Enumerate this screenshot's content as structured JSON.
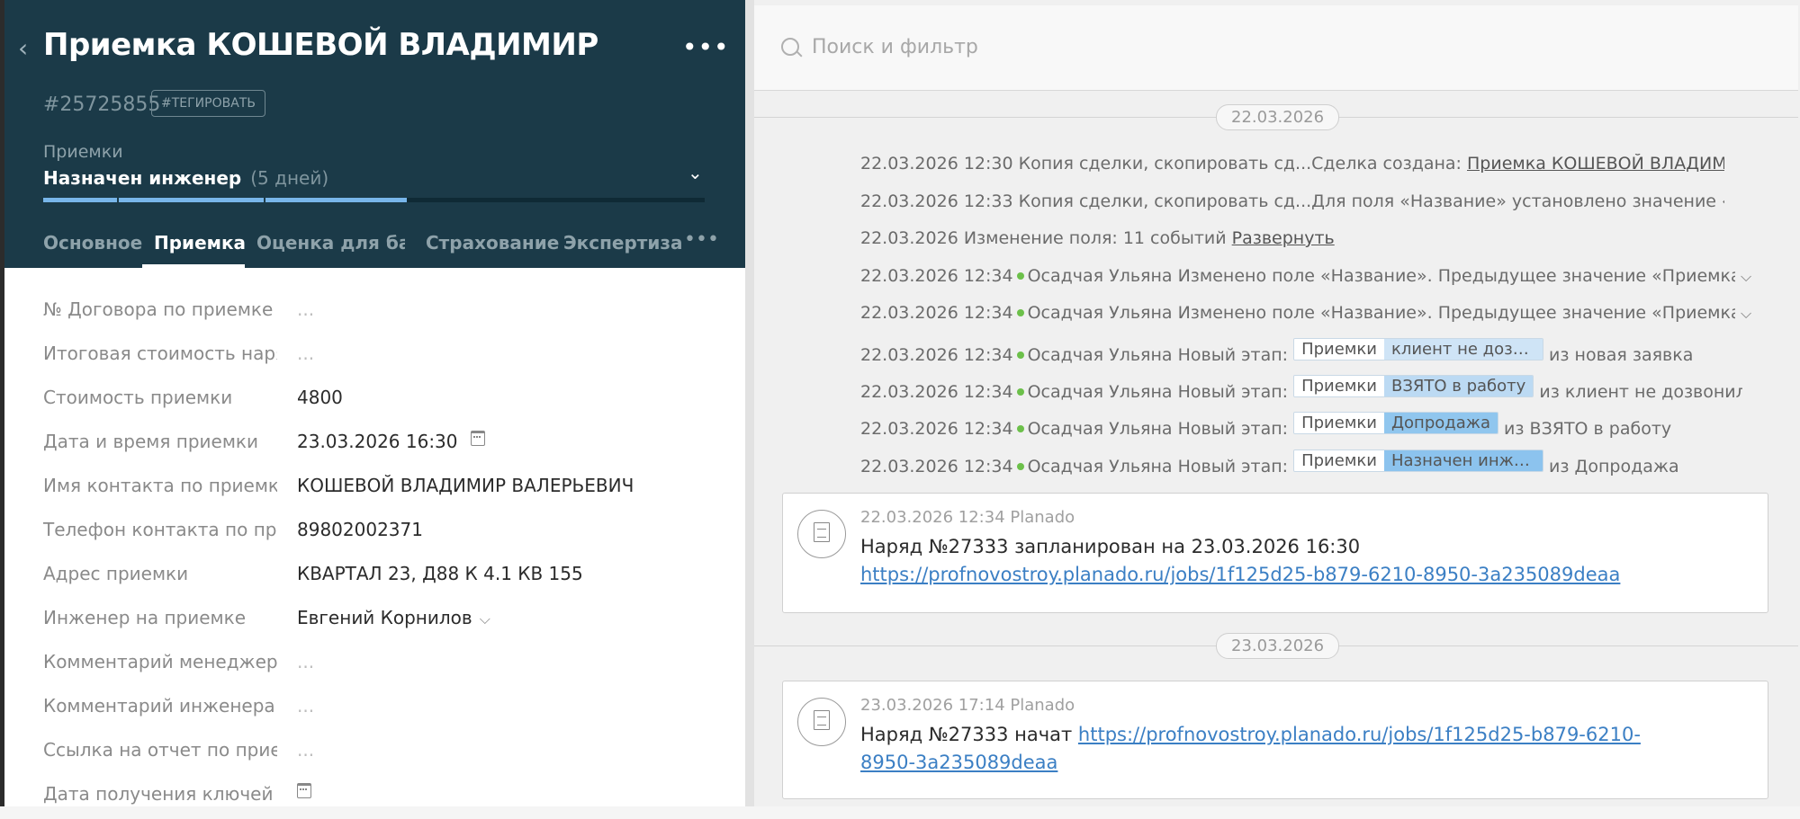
{
  "lead": {
    "title": "Приемка КОШЕВОЙ ВЛАДИМИР",
    "id": "#25725855",
    "tag_label": "#ТЕГИРОВАТЬ",
    "pipeline": "Приемки",
    "stage": "Назначен инженер",
    "stage_days": "(5 дней)",
    "stage_progress": 0.55
  },
  "tabs": [
    {
      "label": "Основное"
    },
    {
      "label": "Приемка"
    },
    {
      "label": "Оценка для бан"
    },
    {
      "label": "Страхование"
    },
    {
      "label": "Экспертиза"
    }
  ],
  "fields": [
    {
      "label": "№ Договора по приемке",
      "value": "..."
    },
    {
      "label": "Итоговая стоимость наряда",
      "value": "..."
    },
    {
      "label": "Стоимость приемки",
      "value": "4800"
    },
    {
      "label": "Дата и время приемки",
      "value": "23.03.2026 16:30"
    },
    {
      "label": "Имя контакта по приемке",
      "value": "КОШЕВОЙ ВЛАДИМИР ВАЛЕРЬЕВИЧ"
    },
    {
      "label": "Телефон контакта по приемке",
      "value": "89802002371"
    },
    {
      "label": "Адрес приемки",
      "value": "КВАРТАЛ 23, Д88 К 4.1 КВ 155"
    },
    {
      "label": "Инженер на приемке",
      "value": "Евгений Корнилов"
    },
    {
      "label": "Комментарий менеджера",
      "value": "..."
    },
    {
      "label": "Комментарий инженера по приемке",
      "value": "..."
    },
    {
      "label": "Ссылка на отчет по приемке",
      "value": "..."
    },
    {
      "label": "Дата получения ключей",
      "value": ""
    }
  ],
  "search": {
    "placeholder": "Поиск и фильтр"
  },
  "dates": [
    "22.03.2026",
    "23.03.2026"
  ],
  "events": [
    {
      "text": "22.03.2026 12:30 Копия сделки, скопировать сд...Сделка создана: ",
      "link": "Приемка КОШЕВОЙ ВЛАДИМИР"
    },
    {
      "text": "22.03.2026 12:33 Копия сделки, скопировать сд...Для поля «Название» установлено значение «Приемка»"
    },
    {
      "text": "22.03.2026 Изменение поля: 11 событий ",
      "link": "Развернуть"
    },
    {
      "time": "22.03.2026 12:34",
      "author": "Осадчая Ульяна",
      "text": "Изменено поле «Название». Предыдущее значение «Приемка», новое значение «Приемка.»"
    },
    {
      "time": "22.03.2026 12:34",
      "author": "Осадчая Ульяна",
      "text": "Изменено поле «Название». Предыдущее значение «Приемка.», новое значение «Приемка»"
    },
    {
      "time": "22.03.2026 12:34",
      "author": "Осадчая Ульяна",
      "label": "Новый этап:",
      "pipe": "Приемки",
      "stage": "клиент не дозв...",
      "from": "из новая заявка",
      "color": "#cfe4f6"
    },
    {
      "time": "22.03.2026 12:34",
      "author": "Осадчая Ульяна",
      "label": "Новый этап:",
      "pipe": "Приемки",
      "stage": "ВЗЯТО в работу",
      "from": "из клиент не дозвонился",
      "color": "#bcdaf3"
    },
    {
      "time": "22.03.2026 12:34",
      "author": "Осадчая Ульяна",
      "label": "Новый этап:",
      "pipe": "Приемки",
      "stage": "Допродажа",
      "from": "из ВЗЯТО в работу",
      "color": "#90c6ee"
    },
    {
      "time": "22.03.2026 12:34",
      "author": "Осадчая Ульяна",
      "label": "Новый этап:",
      "pipe": "Приемки",
      "stage": "Назначен инже...",
      "from": "из Допродажа",
      "color": "#8cc3ee"
    }
  ],
  "notes": [
    {
      "meta": "22.03.2026 12:34 Planado",
      "text": "Наряд №27333 запланирован на 23.03.2026 16:30",
      "link": "https://profnovostroy.planado.ru/jobs/1f125d25-b879-6210-8950-3a235089deaa"
    },
    {
      "meta": "23.03.2026 17:14 Planado",
      "text": "Наряд №27333 начат ",
      "link": "https://profnovostroy.planado.ru/jobs/1f125d25-b879-6210-8950-3a235089deaa"
    }
  ]
}
